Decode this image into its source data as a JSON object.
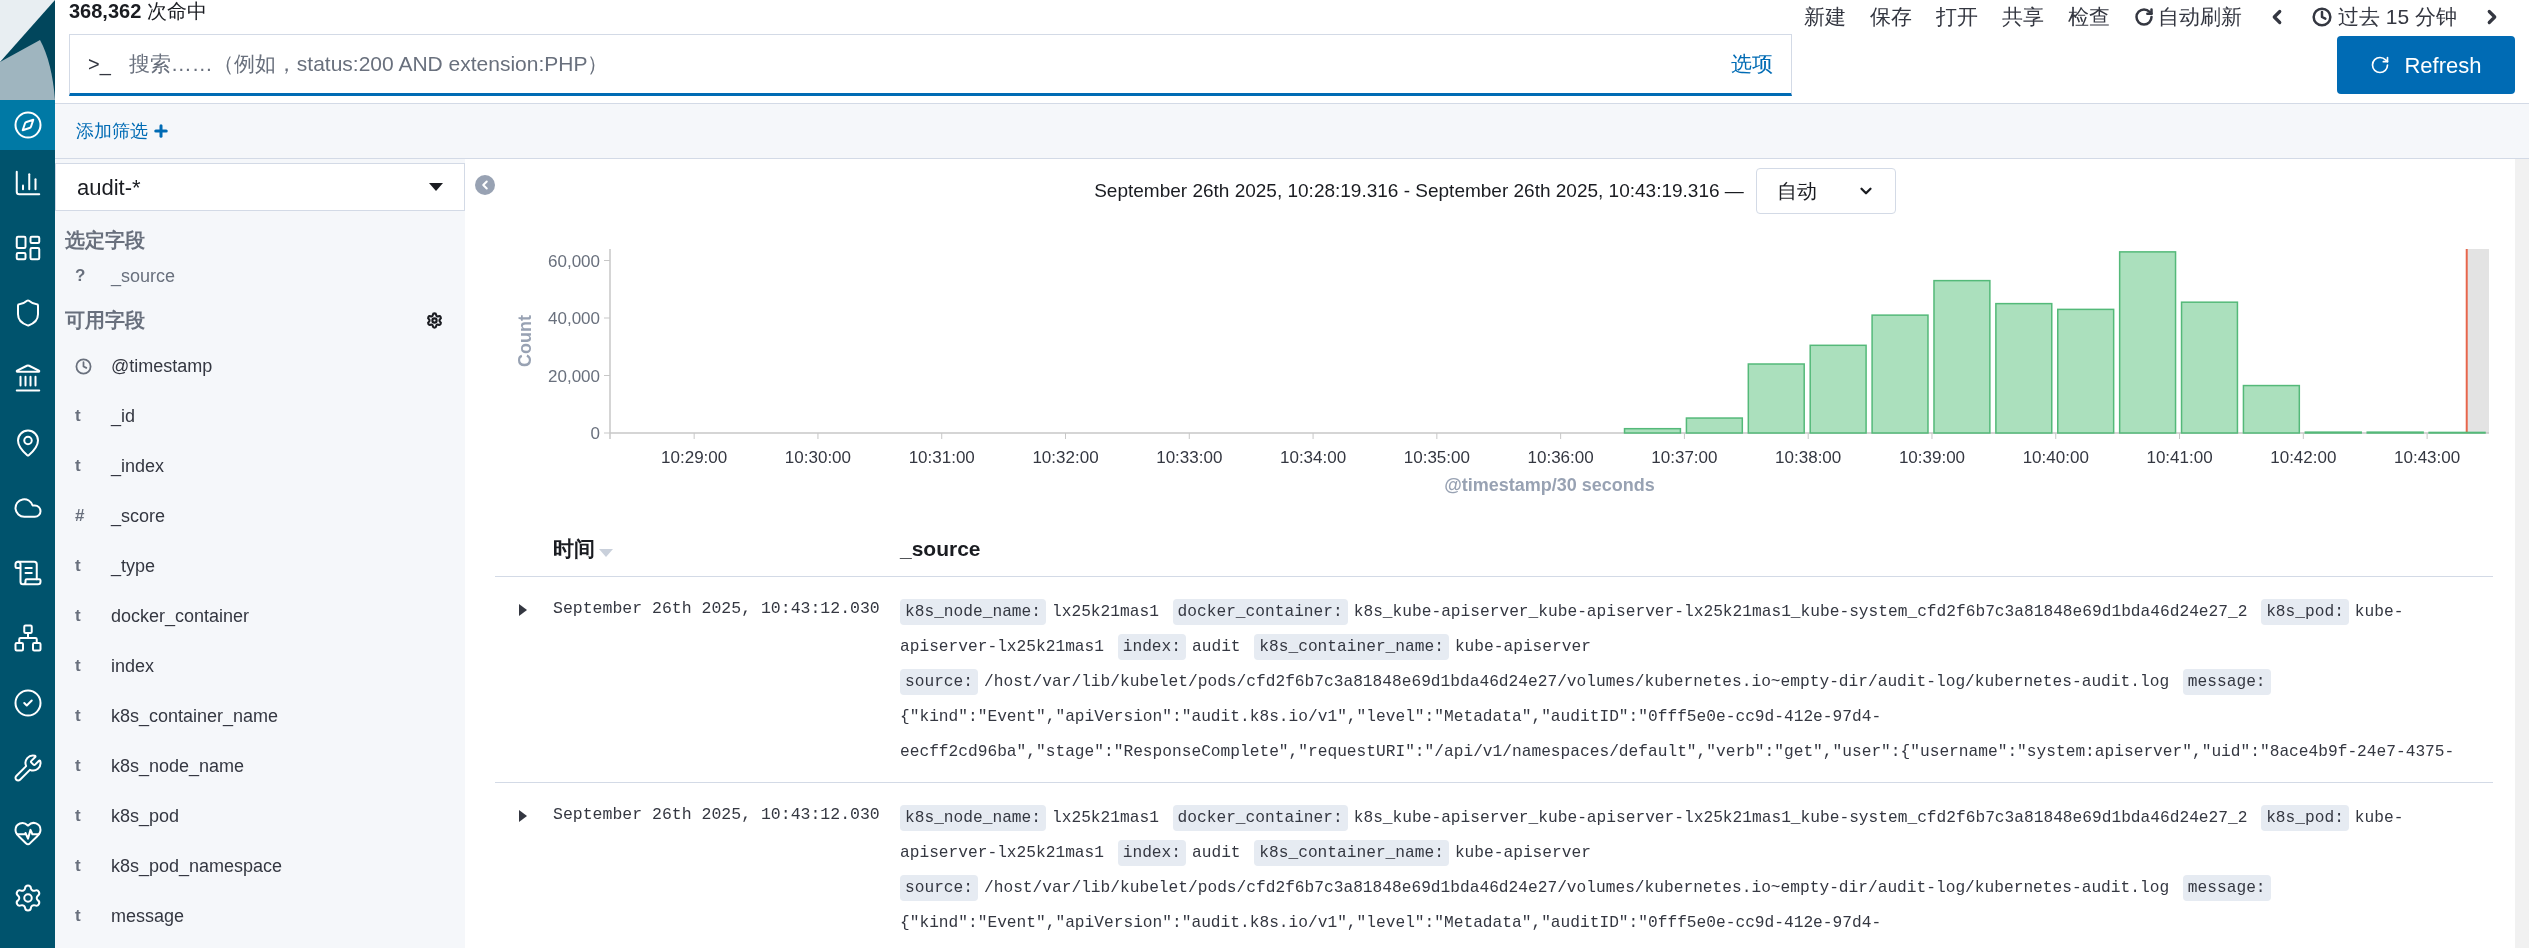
{
  "hits": "**368,362** 次命中",
  "top_menu": [
    {
      "kind": "text",
      "label": "新建"
    },
    {
      "kind": "text",
      "label": "保存"
    },
    {
      "kind": "text",
      "label": "打开"
    },
    {
      "kind": "text",
      "label": "共享"
    },
    {
      "kind": "text",
      "label": "检查"
    },
    {
      "kind": "refresh",
      "label": "自动刷新"
    },
    {
      "kind": "prev"
    },
    {
      "kind": "time",
      "label": "过去 15 分钟"
    },
    {
      "kind": "next"
    }
  ],
  "query": {
    "prompt": ">_",
    "placeholder": "搜索……（例如，status:200 AND extension:PHP）",
    "options": "选项"
  },
  "refresh_button": "Refresh",
  "add_filter": "添加筛选",
  "index_pattern": "audit-*",
  "selected_fields": {
    "title": "选定字段",
    "fields": [
      {
        "kind": "unknown",
        "glyph": "?",
        "name": "_source"
      }
    ]
  },
  "available_fields": {
    "title": "可用字段",
    "fields": [
      {
        "kind": "date",
        "name": "@timestamp"
      },
      {
        "kind": "string",
        "glyph": "t",
        "name": "_id"
      },
      {
        "kind": "string",
        "glyph": "t",
        "name": "_index"
      },
      {
        "kind": "number",
        "glyph": "#",
        "name": "_score"
      },
      {
        "kind": "string",
        "glyph": "t",
        "name": "_type"
      },
      {
        "kind": "string",
        "glyph": "t",
        "name": "docker_container"
      },
      {
        "kind": "string",
        "glyph": "t",
        "name": "index"
      },
      {
        "kind": "string",
        "glyph": "t",
        "name": "k8s_container_name"
      },
      {
        "kind": "string",
        "glyph": "t",
        "name": "k8s_node_name"
      },
      {
        "kind": "string",
        "glyph": "t",
        "name": "k8s_pod"
      },
      {
        "kind": "string",
        "glyph": "t",
        "name": "k8s_pod_namespace"
      },
      {
        "kind": "string",
        "glyph": "t",
        "name": "message"
      }
    ]
  },
  "time_range": "September 26th 2025, 10:28:19.316 - September 26th 2025, 10:43:19.316 —",
  "interval_select": "自动",
  "chart_data": {
    "type": "bar",
    "xlabel": "@timestamp/30 seconds",
    "ylabel": "Count",
    "x": [
      628.75,
      629.25,
      629.75,
      630.25,
      630.75,
      631.25,
      631.75,
      632.25,
      632.75,
      633.25,
      633.75,
      634.25,
      634.75,
      635.25,
      635.75,
      636.25,
      636.75,
      637.25,
      637.75,
      638.25,
      638.75,
      639.25,
      639.75,
      640.25,
      640.75,
      641.25,
      641.75,
      642.25,
      642.75,
      643.25
    ],
    "values": [
      0,
      0,
      0,
      0,
      0,
      0,
      0,
      0,
      0,
      0,
      0,
      0,
      0,
      0,
      0,
      0,
      1500,
      5200,
      24000,
      30500,
      41000,
      53000,
      45000,
      43000,
      63000,
      45500,
      16500,
      300,
      300,
      200
    ],
    "xlim": [
      628.32,
      643.5
    ],
    "ylim": [
      0,
      64000
    ],
    "yticks": [
      {
        "value": 0,
        "label": "0"
      },
      {
        "value": 20000,
        "label": "20,000"
      },
      {
        "value": 40000,
        "label": "40,000"
      },
      {
        "value": 60000,
        "label": "60,000"
      }
    ],
    "xticks": [
      {
        "value": 629,
        "label": "10:29:00"
      },
      {
        "value": 630,
        "label": "10:30:00"
      },
      {
        "value": 631,
        "label": "10:31:00"
      },
      {
        "value": 632,
        "label": "10:32:00"
      },
      {
        "value": 633,
        "label": "10:33:00"
      },
      {
        "value": 634,
        "label": "10:34:00"
      },
      {
        "value": 635,
        "label": "10:35:00"
      },
      {
        "value": 636,
        "label": "10:36:00"
      },
      {
        "value": 637,
        "label": "10:37:00"
      },
      {
        "value": 638,
        "label": "10:38:00"
      },
      {
        "value": 639,
        "label": "10:39:00"
      },
      {
        "value": 640,
        "label": "10:40:00"
      },
      {
        "value": 641,
        "label": "10:41:00"
      },
      {
        "value": 642,
        "label": "10:42:00"
      },
      {
        "value": 643,
        "label": "10:43:00"
      }
    ],
    "ref_lines": [
      {
        "axis": "x",
        "value": 643.32,
        "color": "#e7664c"
      }
    ],
    "bands": [
      {
        "axis": "x",
        "from": 643.32,
        "to": 643.5,
        "color": "#e3e3e3"
      }
    ]
  },
  "nav": [
    {
      "selected": true
    },
    {
      "selected": false
    },
    {
      "selected": false
    },
    {
      "selected": false
    },
    {
      "selected": false
    },
    {
      "selected": false
    },
    {
      "selected": false
    },
    {
      "selected": false
    },
    {
      "selected": false
    },
    {
      "selected": false
    },
    {
      "selected": false
    },
    {
      "selected": false
    },
    {
      "selected": false
    }
  ],
  "table": {
    "columns": [
      {
        "label": "时间",
        "sorted": true
      },
      {
        "label": "_source",
        "sorted": false
      }
    ],
    "rows": [
      {
        "time": "September 26th 2025, 10:43:12.030",
        "fields": [
          {
            "key": "k8s_node_name:",
            "value": "lx25k21mas1"
          },
          {
            "key": "docker_container:",
            "value": "k8s_kube-apiserver_kube-apiserver-lx25k21mas1_kube-system_cfd2f6b7c3a81848e69d1bda46d24e27_2"
          },
          {
            "key": "k8s_pod:",
            "value": "kube-apiserver-lx25k21mas1"
          },
          {
            "key": "index:",
            "value": "audit"
          },
          {
            "key": "k8s_container_name:",
            "value": "kube-apiserver"
          },
          {
            "key": "source:",
            "value": "/host/var/lib/kubelet/pods/cfd2f6b7c3a81848e69d1bda46d24e27/volumes/kubernetes.io~empty-dir/audit-log/kubernetes-audit.log"
          },
          {
            "key": "message:",
            "value": "{\"kind\":\"Event\",\"apiVersion\":\"audit.k8s.io/v1\",\"level\":\"Metadata\",\"auditID\":\"0fff5e0e-cc9d-412e-97d4-eecff2cd96ba\",\"stage\":\"ResponseComplete\",\"requestURI\":\"/api/v1/namespaces/default\",\"verb\":\"get\",\"user\":{\"username\":\"system:apiserver\",\"uid\":\"8ace4b9f-24e7-4375-"
          }
        ]
      },
      {
        "time": "September 26th 2025, 10:43:12.030",
        "fields": [
          {
            "key": "k8s_node_name:",
            "value": "lx25k21mas1"
          },
          {
            "key": "docker_container:",
            "value": "k8s_kube-apiserver_kube-apiserver-lx25k21mas1_kube-system_cfd2f6b7c3a81848e69d1bda46d24e27_2"
          },
          {
            "key": "k8s_pod:",
            "value": "kube-apiserver-lx25k21mas1"
          },
          {
            "key": "index:",
            "value": "audit"
          },
          {
            "key": "k8s_container_name:",
            "value": "kube-apiserver"
          },
          {
            "key": "source:",
            "value": "/host/var/lib/kubelet/pods/cfd2f6b7c3a81848e69d1bda46d24e27/volumes/kubernetes.io~empty-dir/audit-log/kubernetes-audit.log"
          },
          {
            "key": "message:",
            "value": "{\"kind\":\"Event\",\"apiVersion\":\"audit.k8s.io/v1\",\"level\":\"Metadata\",\"auditID\":\"0fff5e0e-cc9d-412e-97d4-"
          }
        ]
      }
    ]
  }
}
